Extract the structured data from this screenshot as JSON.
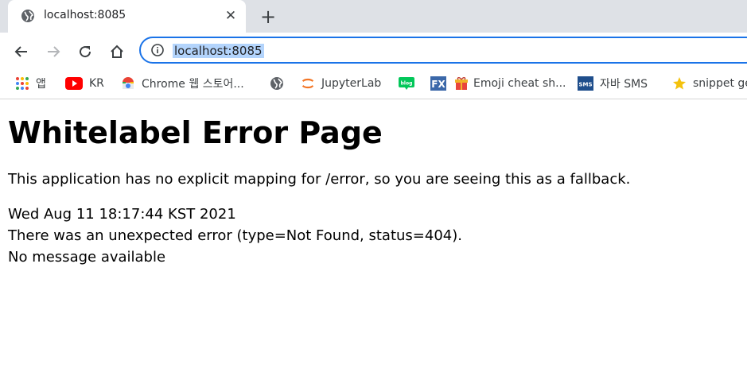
{
  "tab": {
    "title": "localhost:8085"
  },
  "toolbar": {
    "url": "localhost:8085"
  },
  "bookmarks": [
    {
      "label": "앱",
      "icon": "apps-grid-icon"
    },
    {
      "label": "KR",
      "icon": "youtube-icon"
    },
    {
      "label": "Chrome 웹 스토어...",
      "icon": "chrome-webstore-icon"
    },
    {
      "label": "",
      "icon": "globe-icon"
    },
    {
      "label": "JupyterLab",
      "icon": "jupyter-icon"
    },
    {
      "label": "",
      "icon": "blog-icon"
    },
    {
      "label": "",
      "icon": "fx-icon"
    },
    {
      "label": "Emoji cheat sh...",
      "icon": "gift-icon"
    },
    {
      "label": "자바 SMS",
      "icon": "sms-icon"
    },
    {
      "label": "snippet ge",
      "icon": "star-icon"
    }
  ],
  "page": {
    "heading": "Whitelabel Error Page",
    "explanation": "This application has no explicit mapping for /error, so you are seeing this as a fallback.",
    "timestamp": "Wed Aug 11 18:17:44 KST 2021",
    "error": "There was an unexpected error (type=Not Found, status=404).",
    "message": "No message available"
  }
}
